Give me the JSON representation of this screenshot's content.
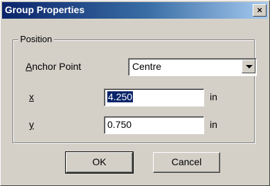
{
  "window": {
    "title": "Group Properties",
    "close_glyph": "×"
  },
  "group": {
    "label": "Position"
  },
  "anchor": {
    "label_mnemonic": "A",
    "label_rest": "nchor Point",
    "selected": "Centre"
  },
  "x_field": {
    "label": "x",
    "value": "4.250",
    "unit": "in"
  },
  "y_field": {
    "label": "y",
    "value": "0.750",
    "unit": "in"
  },
  "buttons": {
    "ok": "OK",
    "cancel": "Cancel"
  },
  "colors": {
    "titlebar_start": "#0a246a",
    "titlebar_end": "#a6caf0",
    "face": "#d4d0c8"
  }
}
